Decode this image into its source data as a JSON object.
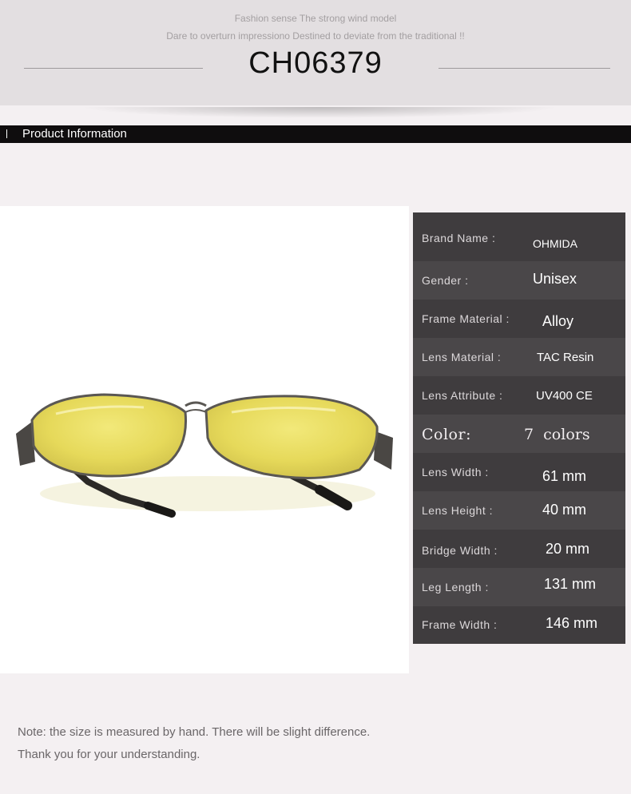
{
  "header": {
    "tagline_1": "Fashion sense The strong wind model",
    "tagline_2": "Dare to overturn impressiono Destined to deviate from the traditional !!",
    "model": "CH06379"
  },
  "section": {
    "title": "Product Information"
  },
  "specs": [
    {
      "label": "Brand Name :",
      "value": "OHMIDA"
    },
    {
      "label": "Gender :",
      "value": "Unisex"
    },
    {
      "label": "Frame Material :",
      "value": "Alloy"
    },
    {
      "label": "Lens Material :",
      "value": "TAC Resin"
    },
    {
      "label": "Lens Attribute :",
      "value": "UV400 CE"
    },
    {
      "label": "Color:",
      "value": "7  colors"
    },
    {
      "label": "Lens Width :",
      "value": "61 mm"
    },
    {
      "label": "Lens Height :",
      "value": "40 mm"
    },
    {
      "label": "Bridge Width :",
      "value": "20 mm"
    },
    {
      "label": "Leg Length :",
      "value": "131 mm"
    },
    {
      "label": "Frame Width :",
      "value": "146 mm"
    }
  ],
  "note": {
    "line_1": "Note: the size is measured by hand. There will be slight difference.",
    "line_2": "Thank you for your understanding."
  },
  "colors": {
    "bar": "#0f0d0e",
    "spec_panel": "#3f3c3e",
    "lens_tint": "#e9df6a"
  }
}
